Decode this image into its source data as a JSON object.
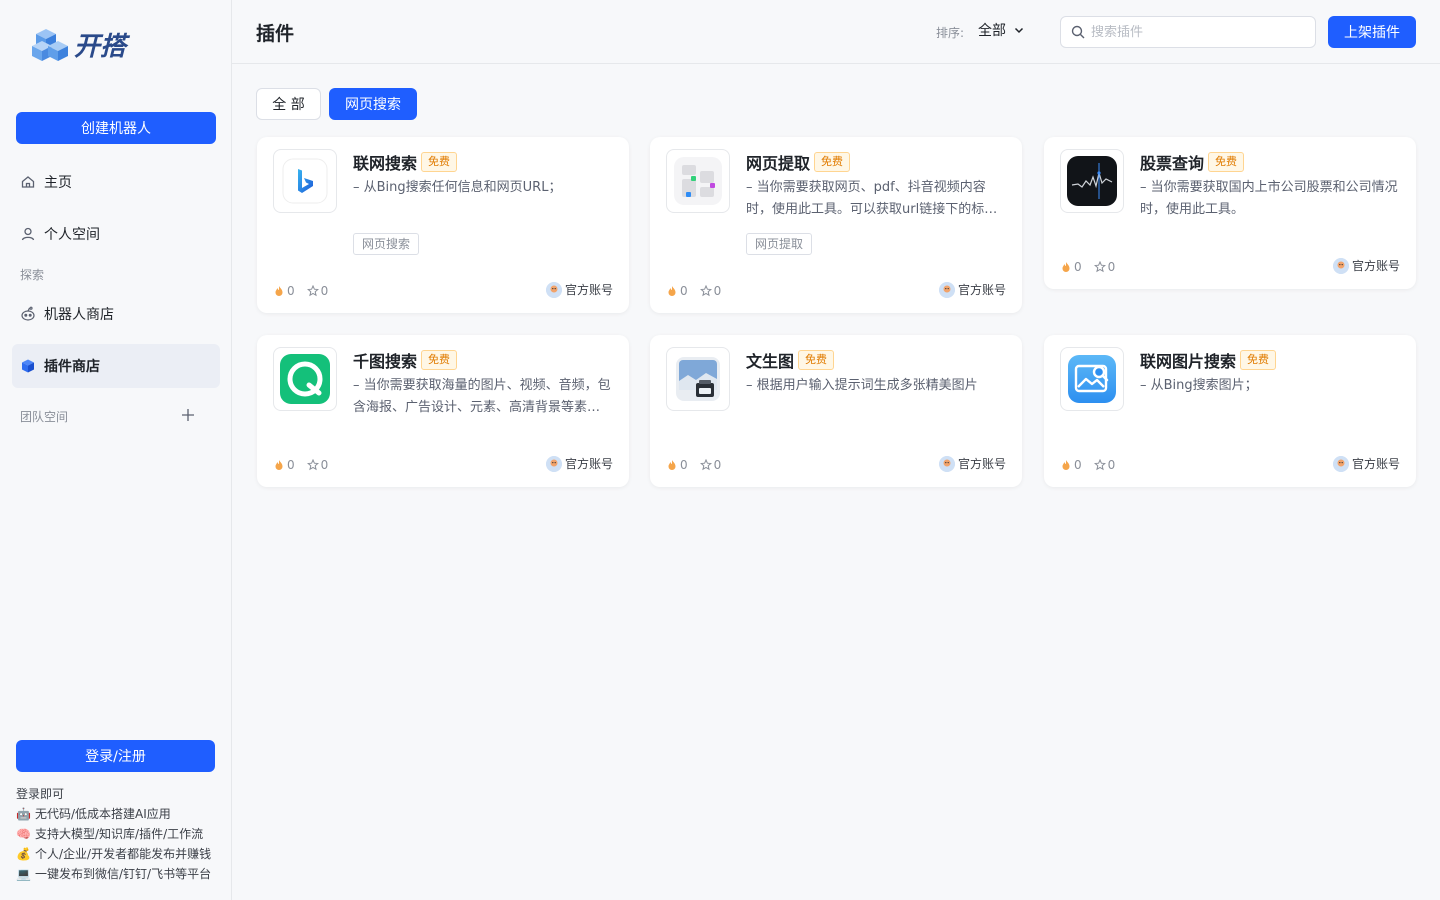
{
  "app": {
    "logo_text": "开搭"
  },
  "sidebar": {
    "create_label": "创建机器人",
    "items": [
      {
        "label": "主页",
        "icon": "home-icon"
      },
      {
        "label": "个人空间",
        "icon": "user-icon"
      },
      {
        "label": "机器人商店",
        "icon": "robot-icon"
      },
      {
        "label": "插件商店",
        "icon": "cube-icon"
      }
    ],
    "explore_label": "探索",
    "team_label": "团队空间",
    "login_label": "登录/注册",
    "promo": {
      "title": "登录即可",
      "lines": [
        {
          "emoji": "🤖",
          "text": "无代码/低成本搭建AI应用"
        },
        {
          "emoji": "🧠",
          "text": "支持大模型/知识库/插件/工作流"
        },
        {
          "emoji": "💰",
          "text": "个人/企业/开发者都能发布并赚钱"
        },
        {
          "emoji": "💻",
          "text": "一键发布到微信/钉钉/飞书等平台"
        }
      ]
    }
  },
  "header": {
    "title": "插件",
    "sort_label": "排序:",
    "sort_value": "全部",
    "search_placeholder": "搜索插件",
    "publish_label": "上架插件"
  },
  "filters": {
    "all": "全 部",
    "web_search": "网页搜索"
  },
  "cards": [
    {
      "name": "联网搜索",
      "badge": "免费",
      "desc": "– 从Bing搜索任何信息和网页URL；",
      "tag": "网页搜索",
      "likes": "0",
      "stars": "0",
      "owner": "官方账号",
      "icon": "bing-icon"
    },
    {
      "name": "网页提取",
      "badge": "免费",
      "desc": "– 当你需要获取网页、pdf、抖音视频内容时，使用此工具。可以获取url链接下的标题、内容、图片等信息。",
      "tag": "网页提取",
      "likes": "0",
      "stars": "0",
      "owner": "官方账号",
      "icon": "web-extract-icon"
    },
    {
      "name": "股票查询",
      "badge": "免费",
      "desc": "– 当你需要获取国内上市公司股票和公司情况时，使用此工具。",
      "tag": "",
      "likes": "0",
      "stars": "0",
      "owner": "官方账号",
      "icon": "stocks-icon"
    },
    {
      "name": "千图搜索",
      "badge": "免费",
      "desc": "– 当你需要获取海量的图片、视频、音频，包含海报、广告设计、元素、高清背景等素材时，使用此工具。",
      "tag": "",
      "likes": "0",
      "stars": "0",
      "owner": "官方账号",
      "icon": "qiantu-icon"
    },
    {
      "name": "文生图",
      "badge": "免费",
      "desc": "– 根据用户输入提示词生成多张精美图片",
      "tag": "",
      "likes": "0",
      "stars": "0",
      "owner": "官方账号",
      "icon": "text-to-image-icon"
    },
    {
      "name": "联网图片搜索",
      "badge": "免费",
      "desc": "– 从Bing搜索图片；",
      "tag": "",
      "likes": "0",
      "stars": "0",
      "owner": "官方账号",
      "icon": "image-search-icon"
    }
  ]
}
